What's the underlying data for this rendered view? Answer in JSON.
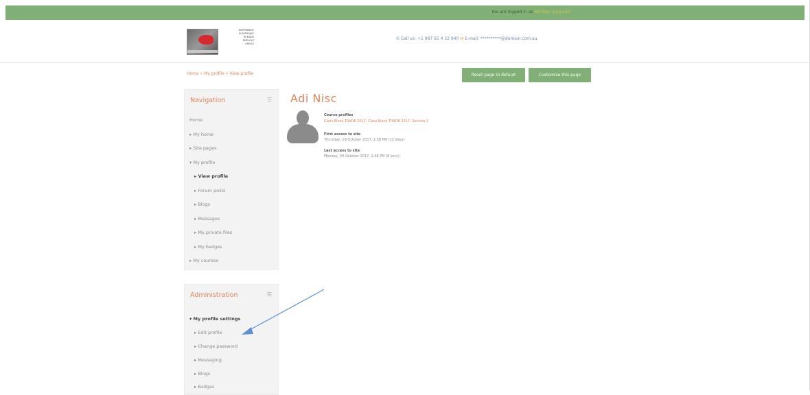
{
  "topbar": {
    "prefix": "You are logged in as",
    "user": "Adi Nisc (Log out)"
  },
  "header": {
    "logo_text": [
      "EXPERIMENT",
      "ELEKTRONIC",
      "IN MADE",
      "EMPLOYE",
      "OREGO"
    ],
    "contact": "Call us: +1 987 65 4 32 940",
    "email": "E-mail: **********@domain.com.au"
  },
  "breadcrumb": "Home » My profile » View profile",
  "buttons": {
    "reset": "Reset page to default",
    "customise": "Customise this page"
  },
  "navigation": {
    "title": "Navigation",
    "items": [
      "Home",
      "My home",
      "Site pages",
      "My profile",
      "View profile",
      "Forum posts",
      "Blogs",
      "Messages",
      "My private files",
      "My badges",
      "My courses"
    ]
  },
  "administration": {
    "title": "Administration",
    "items": [
      "My profile settings",
      "Edit profile",
      "Change password",
      "Messaging",
      "Blogs",
      "Badges"
    ]
  },
  "profile": {
    "name": "Adi Nisc",
    "course_label": "Course profiles",
    "courses": "Class Block TRADE 2017, Class Block TRADE 2017, Session 2",
    "first_access_label": "First access to site",
    "first_access": "Thursday, 19 October 2017, 1:58 PM  (12 days)",
    "last_access_label": "Last access to site",
    "last_access": "Monday, 30 October 2017, 1:48 PM  (8 secs)"
  },
  "colors": {
    "accent": "#e0835a",
    "green": "#80b075",
    "arrow": "#5b8fd6"
  }
}
